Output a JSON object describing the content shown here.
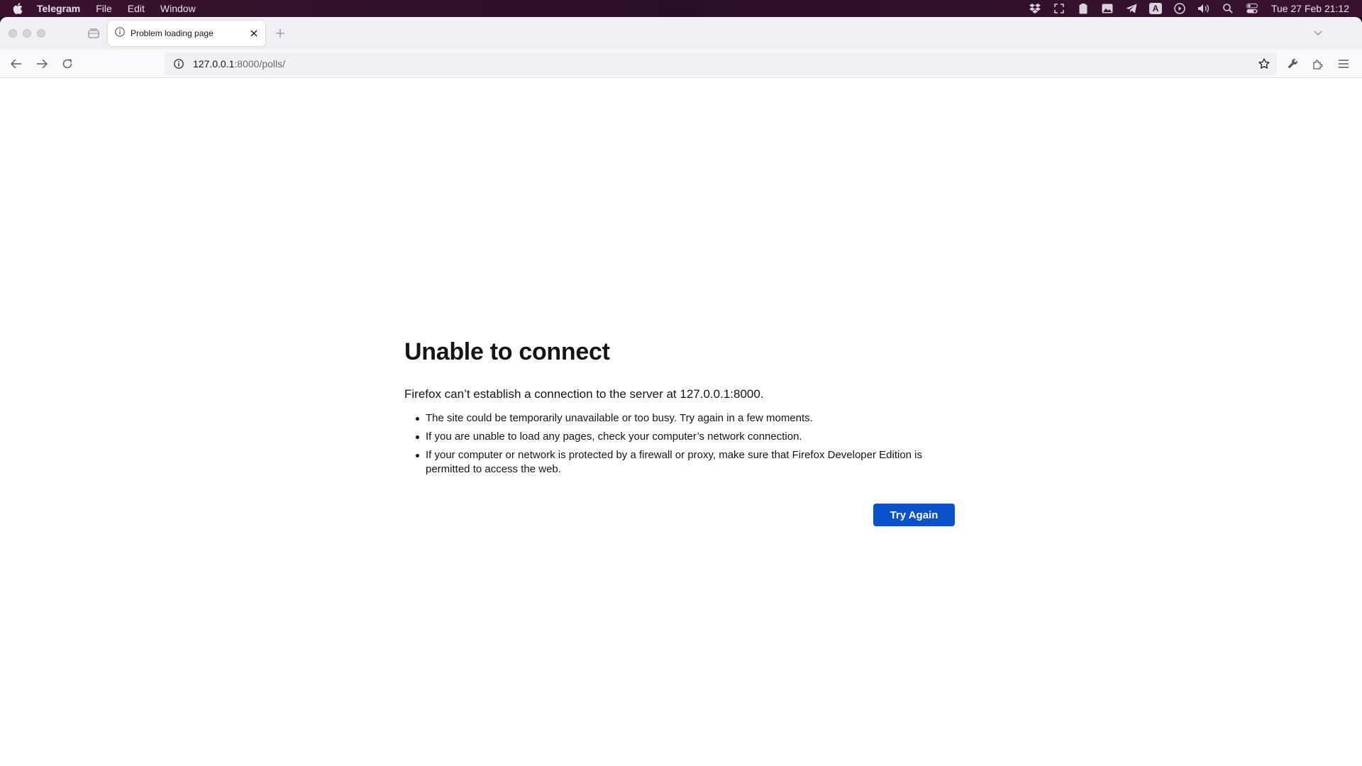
{
  "menubar": {
    "app_name": "Telegram",
    "items": [
      "File",
      "Edit",
      "Window"
    ],
    "status_icons": [
      "dropbox-icon",
      "screenshot-icon",
      "clipboard-icon",
      "image-icon",
      "telegram-icon",
      "input-source-icon",
      "play-icon",
      "volume-icon",
      "search-icon",
      "control-center-icon"
    ],
    "input_source_label": "A",
    "clock": "Tue 27 Feb  21:12"
  },
  "browser": {
    "tab": {
      "title": "Problem loading page"
    },
    "url": {
      "host": "127.0.0.1",
      "path": ":8000/polls/"
    }
  },
  "error_page": {
    "title": "Unable to connect",
    "description": "Firefox can’t establish a connection to the server at 127.0.0.1:8000.",
    "bullets": [
      "The site could be temporarily unavailable or too busy. Try again in a few moments.",
      "If you are unable to load any pages, check your computer’s network connection.",
      "If your computer or network is protected by a firewall or proxy, make sure that Firefox Developer Edition is permitted to access the web."
    ],
    "button_label": "Try Again"
  },
  "colors": {
    "primary_button": "#0a52cc",
    "text": "#15141a"
  }
}
